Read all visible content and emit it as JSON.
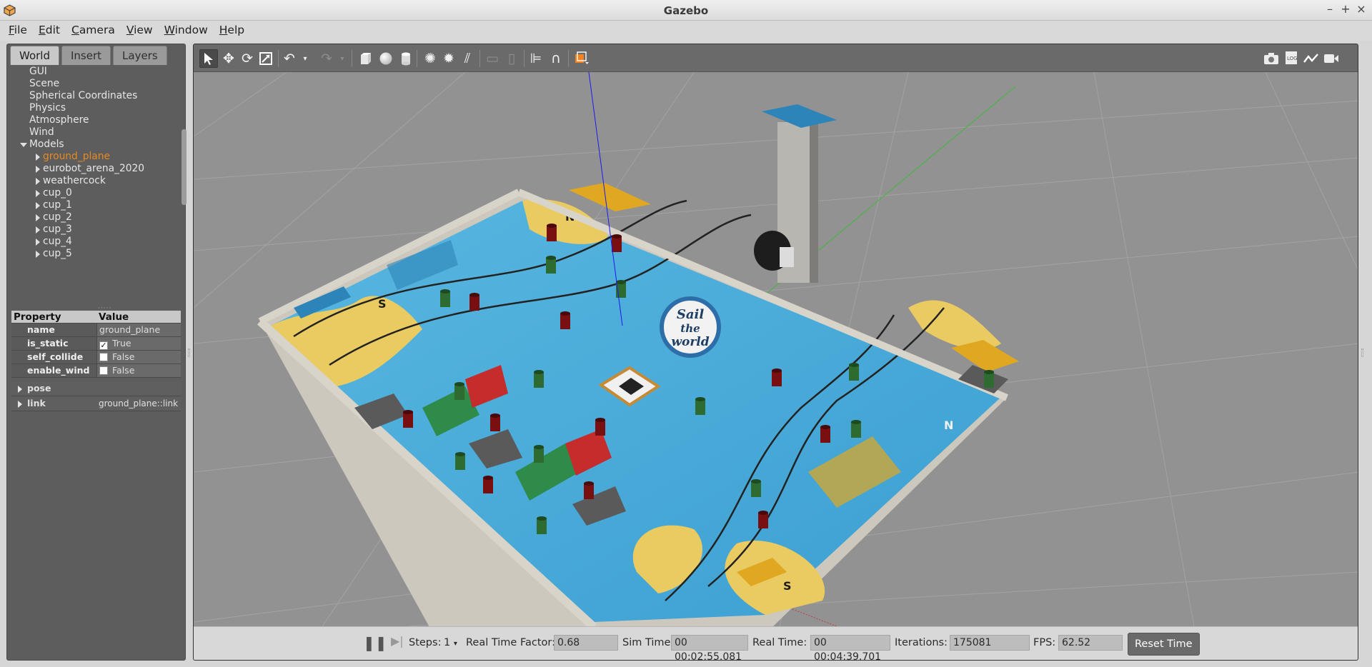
{
  "window": {
    "title": "Gazebo"
  },
  "menu": [
    {
      "label": "File",
      "ul": "F",
      "rest": "ile"
    },
    {
      "label": "Edit",
      "ul": "E",
      "rest": "dit"
    },
    {
      "label": "Camera",
      "ul": "C",
      "rest": "amera"
    },
    {
      "label": "View",
      "ul": "V",
      "rest": "iew"
    },
    {
      "label": "Window",
      "ul": "W",
      "rest": "indow"
    },
    {
      "label": "Help",
      "ul": "H",
      "rest": "elp"
    }
  ],
  "tabs": [
    "World",
    "Insert",
    "Layers"
  ],
  "tree": {
    "top_items": [
      "GUI",
      "Scene",
      "Spherical Coordinates",
      "Physics",
      "Atmosphere",
      "Wind"
    ],
    "models_label": "Models",
    "models": [
      "ground_plane",
      "eurobot_arena_2020",
      "weathercock",
      "cup_0",
      "cup_1",
      "cup_2",
      "cup_3",
      "cup_4",
      "cup_5"
    ],
    "selected": "ground_plane"
  },
  "properties": {
    "header_property": "Property",
    "header_value": "Value",
    "rows": [
      {
        "key": "name",
        "value": "ground_plane",
        "checkbox": false
      },
      {
        "key": "is_static",
        "value": "True",
        "checkbox": true,
        "checked": true
      },
      {
        "key": "self_collide",
        "value": "False",
        "checkbox": true,
        "checked": false
      },
      {
        "key": "enable_wind",
        "value": "False",
        "checkbox": true,
        "checked": false
      }
    ],
    "expandables": [
      {
        "key": "pose",
        "value": ""
      },
      {
        "key": "link",
        "value": "ground_plane::link"
      }
    ]
  },
  "toolbar_icons": [
    "select-arrow-icon",
    "translate-icon",
    "rotate-icon",
    "scale-icon",
    "undo-icon",
    "undo-dropdown-icon",
    "redo-icon",
    "redo-dropdown-icon",
    "box-icon",
    "sphere-icon",
    "cylinder-icon",
    "point-light-icon",
    "spot-light-icon",
    "directional-light-icon",
    "copy-icon",
    "paste-icon",
    "align-icon",
    "snap-icon",
    "view-angle-icon"
  ],
  "right_toolbar_icons": [
    "screenshot-icon",
    "log-icon",
    "plot-icon",
    "video-record-icon"
  ],
  "scene_text": {
    "logo_line1": "Sail",
    "logo_line2": "the",
    "logo_line3": "world",
    "north": "N",
    "south": "S"
  },
  "bottom": {
    "steps_label": "Steps:",
    "steps_value": "1",
    "rtf_label": "Real Time Factor:",
    "rtf_value": "0.68",
    "sim_label": "Sim Time:",
    "sim_value": "00 00:02:55.081",
    "real_label": "Real Time:",
    "real_value": "00 00:04:39.701",
    "iter_label": "Iterations:",
    "iter_value": "175081",
    "fps_label": "FPS:",
    "fps_value": "62.52",
    "reset_label": "Reset Time"
  },
  "colors": {
    "selected_text": "#e8891f",
    "water": "#4aa8d8",
    "sand": "#e8c85a",
    "wall": "#cfcac0",
    "red_cup": "#7a0f12",
    "green_cup": "#2e6b30",
    "yellow_zone": "#e0a820",
    "blue_zone": "#2d84b8"
  }
}
